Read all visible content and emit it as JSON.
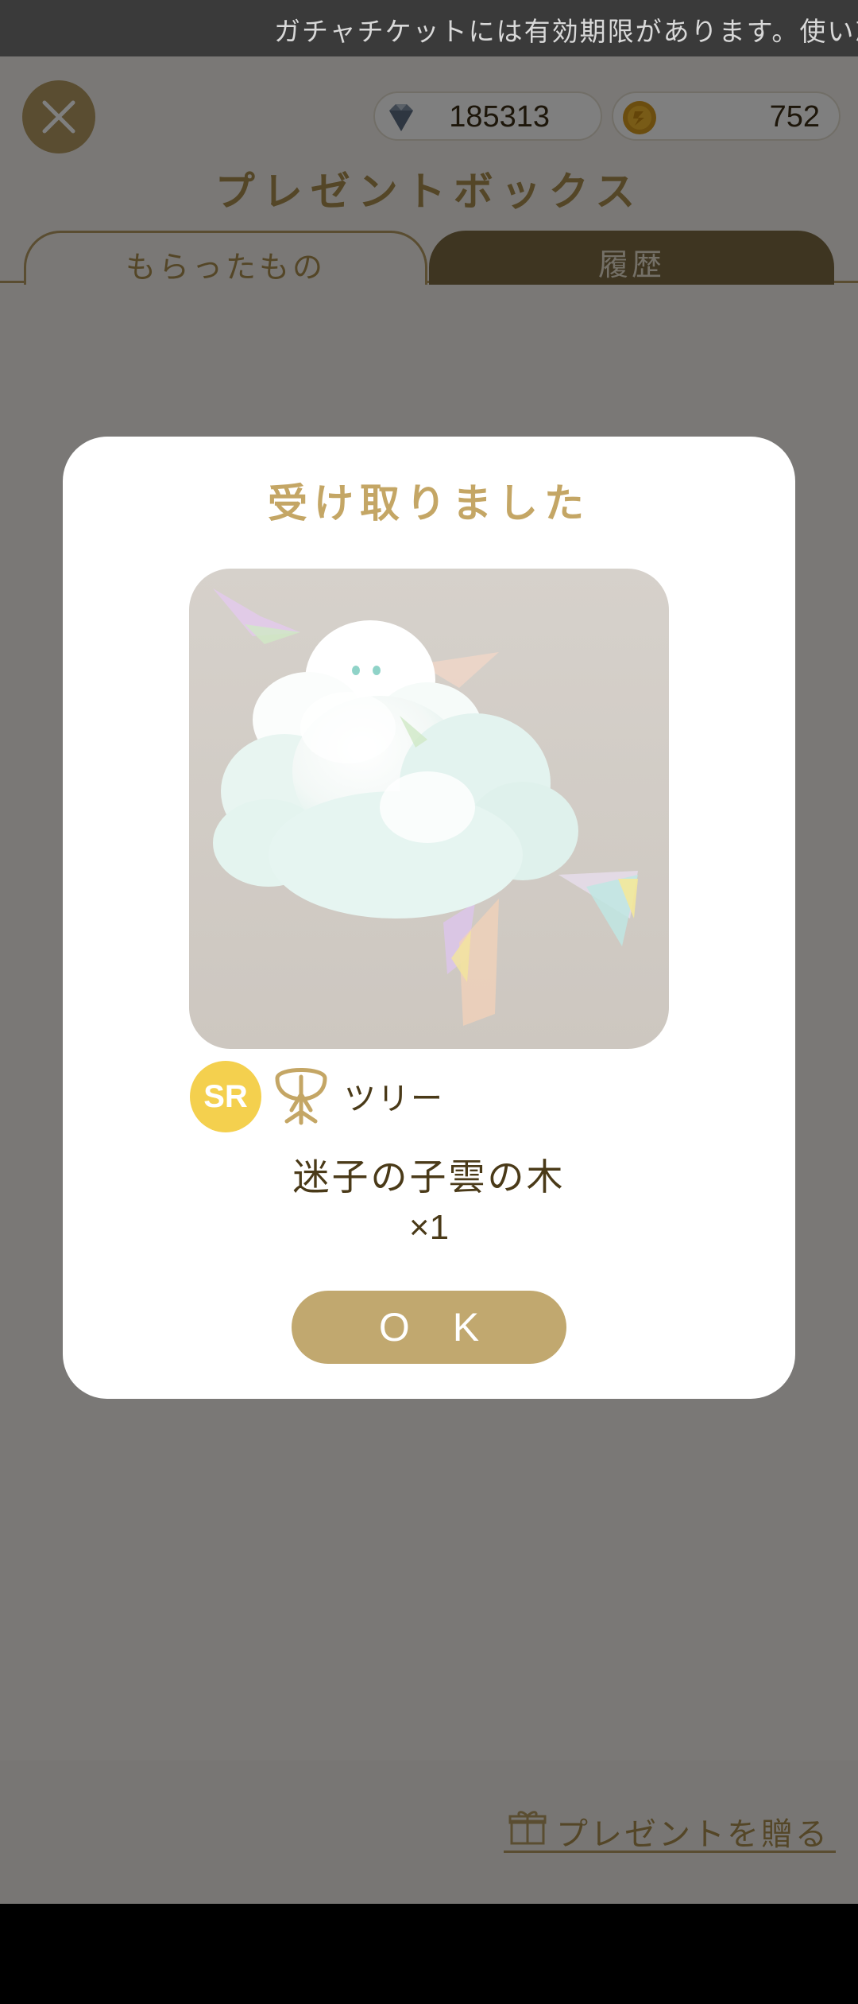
{
  "ticker": {
    "text": "ガチャチケットには有効期限があります。使い忘"
  },
  "header": {
    "gems": "185313",
    "coins": "752",
    "title": "プレゼントボックス"
  },
  "tabs": {
    "received": "もらったもの",
    "history": "履歴"
  },
  "footer": {
    "send_gift": "プレゼントを贈る"
  },
  "modal": {
    "title": "受け取りました",
    "rarity": "SR",
    "category": "ツリー",
    "item_name": "迷子の子雲の木",
    "quantity": "×1",
    "ok_label": "O K"
  },
  "colors": {
    "accent_gold": "#c4a665",
    "button_gold": "#c1a86f",
    "rarity_sr": "#f4d04e",
    "text_brown": "#4a3a18"
  },
  "icons": [
    "close-icon",
    "diamond-icon",
    "coin-icon",
    "tree-icon",
    "gift-icon"
  ]
}
